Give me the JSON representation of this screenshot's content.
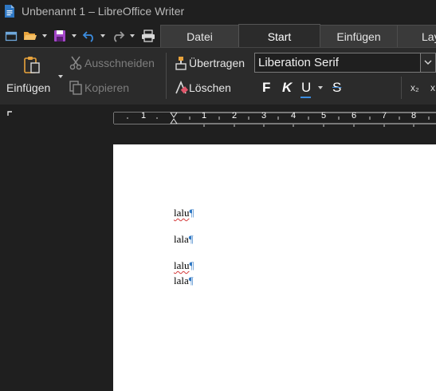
{
  "window": {
    "title": "Unbenannt 1 – LibreOffice Writer"
  },
  "quick_toolbar": {
    "icons": [
      "new-document-icon",
      "open-folder-icon",
      "save-icon",
      "undo-icon",
      "redo-icon",
      "print-icon"
    ]
  },
  "tabs": [
    {
      "label": "Datei",
      "active": false
    },
    {
      "label": "Start",
      "active": true
    },
    {
      "label": "Einfügen",
      "active": false
    },
    {
      "label": "Lay",
      "active": false
    }
  ],
  "ribbon": {
    "paste_label": "Einfügen",
    "cut_label": "Ausschneiden",
    "copy_label": "Kopieren",
    "clone_label": "Übertragen",
    "clear_label": "Löschen",
    "font_name": "Liberation Serif",
    "bold_label": "F",
    "italic_label": "K",
    "underline_label": "U",
    "strike_label": "S",
    "subscript_label": "x₂",
    "superscript_label": "x"
  },
  "ruler": {
    "numbers": [
      "1",
      "1",
      "2",
      "3",
      "4",
      "5",
      "6",
      "7",
      "8"
    ]
  },
  "document": {
    "paragraphs": [
      {
        "text": "lalu",
        "misspelled": true
      },
      {
        "text": "lala",
        "misspelled": false
      },
      {
        "text": "lalu",
        "misspelled": true
      },
      {
        "text": "lala",
        "misspelled": false
      }
    ],
    "pilcrow": "¶"
  },
  "colors": {
    "accent": "#2f78c4",
    "spellcheck": "#d43a3a"
  }
}
